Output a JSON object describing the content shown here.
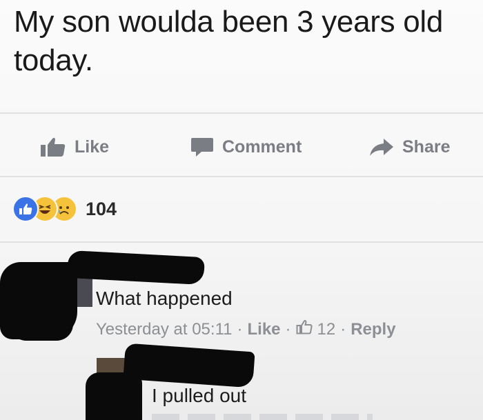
{
  "post": {
    "text": "My son woulda been 3 years old today."
  },
  "actions": {
    "like_label": "Like",
    "comment_label": "Comment",
    "share_label": "Share"
  },
  "reactions": {
    "icons": [
      "like-reaction-icon",
      "haha-reaction-icon",
      "sad-reaction-icon"
    ],
    "count": "104"
  },
  "comments": [
    {
      "text": "What happened",
      "time": "Yesterday at 05:11",
      "like_label": "Like",
      "like_count": "12",
      "reply_label": "Reply"
    },
    {
      "text": "I pulled out"
    }
  ],
  "colors": {
    "accent": "#3b73e6",
    "muted_text": "#8c8f94",
    "redaction": "#0a0a0a"
  }
}
